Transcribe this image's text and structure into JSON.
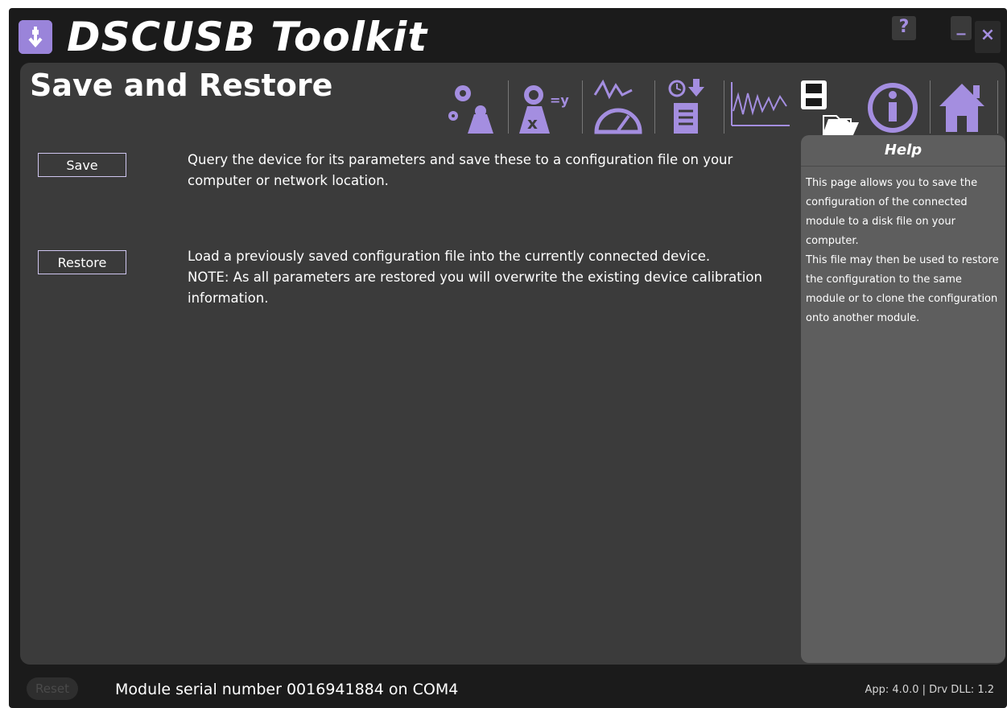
{
  "app": {
    "title": "DSCUSB Toolkit",
    "help_glyph": "?",
    "minimize_glyph": "_",
    "close_glyph": "×"
  },
  "page": {
    "title": "Save and Restore"
  },
  "toolbar": {
    "items": [
      {
        "name": "settings-weight-icon"
      },
      {
        "name": "calibration-formula-icon"
      },
      {
        "name": "gauge-readout-icon"
      },
      {
        "name": "timed-log-report-icon"
      },
      {
        "name": "chart-icon"
      },
      {
        "name": "save-restore-icon"
      },
      {
        "name": "info-icon"
      },
      {
        "name": "home-icon"
      }
    ]
  },
  "actions": {
    "save": {
      "label": "Save",
      "description": "Query the device for its parameters and save these to a configuration file on your computer or network location."
    },
    "restore": {
      "label": "Restore",
      "description_line1": "Load a previously saved configuration file into the currently connected device.",
      "description_line2": "NOTE: As all parameters are restored you will overwrite the existing device calibration information."
    }
  },
  "help": {
    "title": "Help",
    "body_part1": "This page allows you to save the configuration of the connected module to a disk file on your computer.",
    "body_part2": "This file may then be used to restore the configuration to the same module or to clone the configuration onto another module."
  },
  "status": {
    "reset_label": "Reset",
    "module_text": "Module serial number 0016941884 on COM4",
    "version_text": "App: 4.0.0 | Drv DLL: 1.2"
  },
  "colors": {
    "accent": "#9a84da",
    "background": "#1b1b1b",
    "panel": "#3b3b3b",
    "help_panel": "#5e5e5e"
  }
}
